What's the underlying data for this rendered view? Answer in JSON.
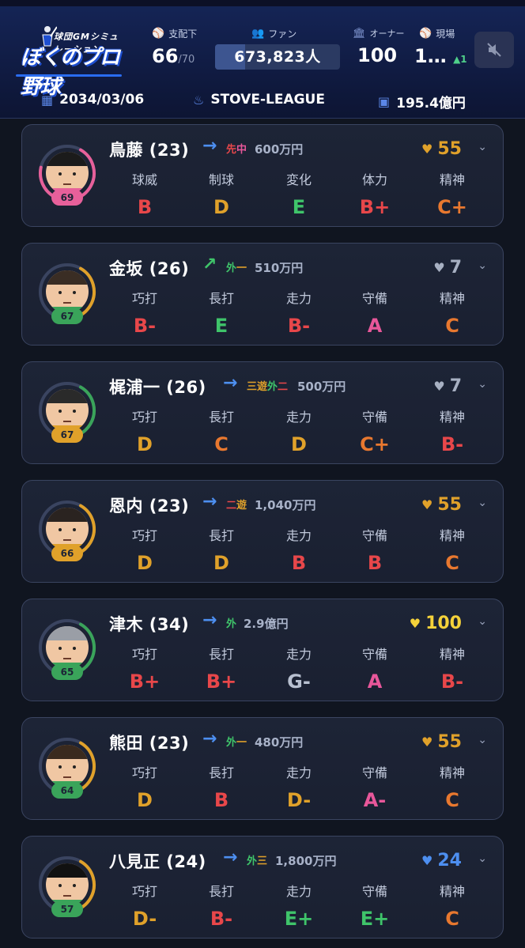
{
  "header": {
    "logo_sub": "球団GMシミュレーション",
    "logo_main": "ぼくのプロ野球",
    "controlled": {
      "label": "支配下",
      "value": "66",
      "max": "/70",
      "icon": "baseball-icon"
    },
    "fans": {
      "label": "ファン",
      "value": "673,823人",
      "fill_fraction": 0.24,
      "icon": "people-icon"
    },
    "owner": {
      "label": "オーナー",
      "value": "100",
      "icon": "building-icon"
    },
    "field": {
      "label": "現場",
      "value": "1…",
      "delta": "▲1",
      "icon": "batter-icon"
    },
    "mute_icon": "speaker-muted-icon"
  },
  "info": {
    "date": "2034/03/06",
    "phase": "STOVE-LEAGUE",
    "money": "195.4億円",
    "date_icon": "calendar-icon",
    "phase_icon": "flame-icon",
    "money_icon": "cash-icon"
  },
  "colors": {
    "A": "#e8579a",
    "B": "#e8474a",
    "C": "#e8782f",
    "D": "#e0a12a",
    "E": "#3fc46a",
    "G": "#b8c0d0",
    "heart_gold": "#e0a12a",
    "heart_gray": "#a7b0c2",
    "heart_yellow": "#f5d23a",
    "heart_blue": "#4d8ff0"
  },
  "players": [
    {
      "name": "鳥藤 (23)",
      "arrow": "→",
      "arrow_color": "#4d8ff0",
      "pos": [
        {
          "t": "先",
          "c": "#e8474a"
        },
        {
          "t": "中",
          "c": "#e8579a"
        }
      ],
      "salary": "600万円",
      "heart": "55",
      "heart_color": "#e0a12a",
      "ovr": "69",
      "badge_color": "#e7609a",
      "ring_color": "#e7609a",
      "ring_fraction": 0.7,
      "hair": "#1b1b1b",
      "shirt": "#e7609a",
      "stats": [
        {
          "label": "球威",
          "grade": "B"
        },
        {
          "label": "制球",
          "grade": "D"
        },
        {
          "label": "変化",
          "grade": "E"
        },
        {
          "label": "体力",
          "grade": "B+"
        },
        {
          "label": "精神",
          "grade": "C+"
        }
      ]
    },
    {
      "name": "金坂 (26)",
      "arrow": "↗",
      "arrow_color": "#3fc46a",
      "pos": [
        {
          "t": "外",
          "c": "#3fc46a"
        },
        {
          "t": "一",
          "c": "#e0a12a"
        }
      ],
      "salary": "510万円",
      "heart": "7",
      "heart_color": "#a7b0c2",
      "ovr": "67",
      "badge_color": "#3aa45a",
      "ring_color": "#e0a12a",
      "ring_fraction": 0.5,
      "hair": "#3a2d24",
      "shirt": "#3aa45a",
      "stats": [
        {
          "label": "巧打",
          "grade": "B-"
        },
        {
          "label": "長打",
          "grade": "E"
        },
        {
          "label": "走力",
          "grade": "B-"
        },
        {
          "label": "守備",
          "grade": "A"
        },
        {
          "label": "精神",
          "grade": "C"
        }
      ]
    },
    {
      "name": "梶浦一 (26)",
      "arrow": "→",
      "arrow_color": "#4d8ff0",
      "pos": [
        {
          "t": "三",
          "c": "#e0a12a"
        },
        {
          "t": "遊",
          "c": "#e0a12a"
        },
        {
          "t": "外",
          "c": "#3fc46a"
        },
        {
          "t": "二",
          "c": "#e8474a"
        }
      ],
      "salary": "500万円",
      "heart": "7",
      "heart_color": "#a7b0c2",
      "ovr": "67",
      "badge_color": "#e0a12a",
      "ring_color": "#3aa45a",
      "ring_fraction": 0.45,
      "hair": "#2a2a2a",
      "shirt": "#e0a12a",
      "stats": [
        {
          "label": "巧打",
          "grade": "D"
        },
        {
          "label": "長打",
          "grade": "C"
        },
        {
          "label": "走力",
          "grade": "D"
        },
        {
          "label": "守備",
          "grade": "C+"
        },
        {
          "label": "精神",
          "grade": "B-"
        }
      ]
    },
    {
      "name": "恩内 (23)",
      "arrow": "→",
      "arrow_color": "#4d8ff0",
      "pos": [
        {
          "t": "二",
          "c": "#e8474a"
        },
        {
          "t": "遊",
          "c": "#e0a12a"
        }
      ],
      "salary": "1,040万円",
      "heart": "55",
      "heart_color": "#e0a12a",
      "ovr": "66",
      "badge_color": "#e0a12a",
      "ring_color": "#e0a12a",
      "ring_fraction": 0.45,
      "hair": "#2a2320",
      "shirt": "#e0a12a",
      "stats": [
        {
          "label": "巧打",
          "grade": "D"
        },
        {
          "label": "長打",
          "grade": "D"
        },
        {
          "label": "走力",
          "grade": "B"
        },
        {
          "label": "守備",
          "grade": "B"
        },
        {
          "label": "精神",
          "grade": "C"
        }
      ]
    },
    {
      "name": "津木 (34)",
      "arrow": "→",
      "arrow_color": "#4d8ff0",
      "pos": [
        {
          "t": "外",
          "c": "#3fc46a"
        }
      ],
      "salary": "2.9億円",
      "heart": "100",
      "heart_color": "#f5d23a",
      "ovr": "65",
      "badge_color": "#3aa45a",
      "ring_color": "#3aa45a",
      "ring_fraction": 0.4,
      "hair": "#9a9ea6",
      "shirt": "#3aa45a",
      "stats": [
        {
          "label": "巧打",
          "grade": "B+"
        },
        {
          "label": "長打",
          "grade": "B+"
        },
        {
          "label": "走力",
          "grade": "G-"
        },
        {
          "label": "守備",
          "grade": "A"
        },
        {
          "label": "精神",
          "grade": "B-"
        }
      ]
    },
    {
      "name": "熊田 (23)",
      "arrow": "→",
      "arrow_color": "#4d8ff0",
      "pos": [
        {
          "t": "外",
          "c": "#3fc46a"
        },
        {
          "t": "一",
          "c": "#e0a12a"
        }
      ],
      "salary": "480万円",
      "heart": "55",
      "heart_color": "#e0a12a",
      "ovr": "64",
      "badge_color": "#3aa45a",
      "ring_color": "#e0a12a",
      "ring_fraction": 0.4,
      "hair": "#3a2a1e",
      "shirt": "#3aa45a",
      "stats": [
        {
          "label": "巧打",
          "grade": "D"
        },
        {
          "label": "長打",
          "grade": "B"
        },
        {
          "label": "走力",
          "grade": "D-"
        },
        {
          "label": "守備",
          "grade": "A-"
        },
        {
          "label": "精神",
          "grade": "C"
        }
      ]
    },
    {
      "name": "八見正 (24)",
      "arrow": "→",
      "arrow_color": "#4d8ff0",
      "pos": [
        {
          "t": "外",
          "c": "#3fc46a"
        },
        {
          "t": "三",
          "c": "#e0a12a"
        }
      ],
      "salary": "1,800万円",
      "heart": "24",
      "heart_color": "#4d8ff0",
      "ovr": "57",
      "badge_color": "#3aa45a",
      "ring_color": "#e0a12a",
      "ring_fraction": 0.35,
      "hair": "#111",
      "shirt": "#3aa45a",
      "stats": [
        {
          "label": "巧打",
          "grade": "D-"
        },
        {
          "label": "長打",
          "grade": "B-"
        },
        {
          "label": "走力",
          "grade": "E+"
        },
        {
          "label": "守備",
          "grade": "E+"
        },
        {
          "label": "精神",
          "grade": "C"
        }
      ]
    }
  ]
}
